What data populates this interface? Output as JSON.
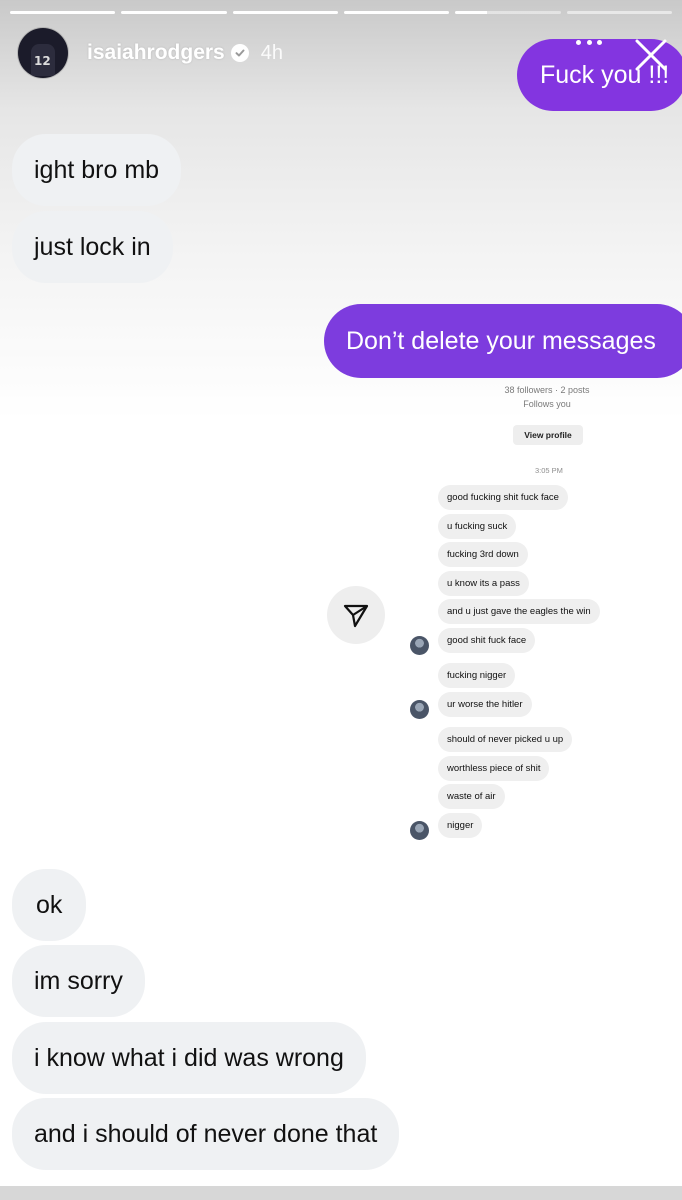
{
  "story": {
    "username": "isaiahrodgers",
    "time_ago": "4h",
    "avatar_number": "12"
  },
  "icons": [
    "verified-badge-icon",
    "more-options-icon",
    "close-icon",
    "share-icon"
  ],
  "colors": {
    "sent_bubble": "#7d3cde",
    "received_bubble": "#eff1f3"
  },
  "messages": [
    {
      "text": "Fuck you !!!",
      "side": "right"
    },
    {
      "text": "ight bro mb",
      "side": "left"
    },
    {
      "text": "just lock in",
      "side": "left"
    },
    {
      "text": "Don’t delete your messages",
      "side": "right"
    },
    {
      "text": "ok",
      "side": "left"
    },
    {
      "text": "im sorry",
      "side": "left"
    },
    {
      "text": "i know what i did was wrong",
      "side": "left"
    },
    {
      "text": "and i should of never done that",
      "side": "left"
    }
  ],
  "embedded_screenshot": {
    "followers_line": "38 followers · 2 posts",
    "follows_line": "Follows you",
    "view_profile_label": "View profile",
    "timestamp": "3:05 PM",
    "messages": [
      "good fucking shit fuck face",
      "u fucking suck",
      "fucking 3rd down",
      "u know its a pass",
      "and u just gave the eagles the win",
      "good shit fuck face",
      "fucking nigger",
      "ur worse the hitler",
      "should of never picked u up",
      "worthless piece of shit",
      "waste of air",
      "nigger"
    ]
  }
}
